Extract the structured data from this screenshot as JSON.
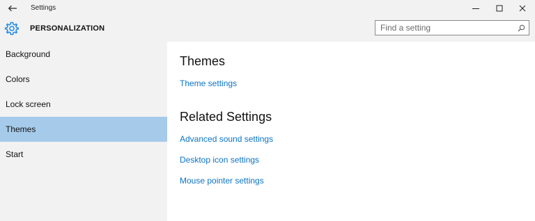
{
  "window": {
    "title": "Settings",
    "controls": {
      "minimize": "—",
      "maximize": "☐",
      "close": "✕"
    }
  },
  "header": {
    "title": "PERSONALIZATION",
    "icon": "gear-icon",
    "search_placeholder": "Find a setting"
  },
  "sidebar": {
    "items": [
      {
        "label": "Background",
        "selected": false
      },
      {
        "label": "Colors",
        "selected": false
      },
      {
        "label": "Lock screen",
        "selected": false
      },
      {
        "label": "Themes",
        "selected": true
      },
      {
        "label": "Start",
        "selected": false
      }
    ]
  },
  "main": {
    "themes_heading": "Themes",
    "theme_settings_link": "Theme settings",
    "related_heading": "Related Settings",
    "related_links": [
      "Advanced sound settings",
      "Desktop icon settings",
      "Mouse pointer settings"
    ]
  },
  "colors": {
    "accent": "#0a74c8",
    "selected_bg": "#a6cbea",
    "chrome_bg": "#f2f2f2"
  }
}
